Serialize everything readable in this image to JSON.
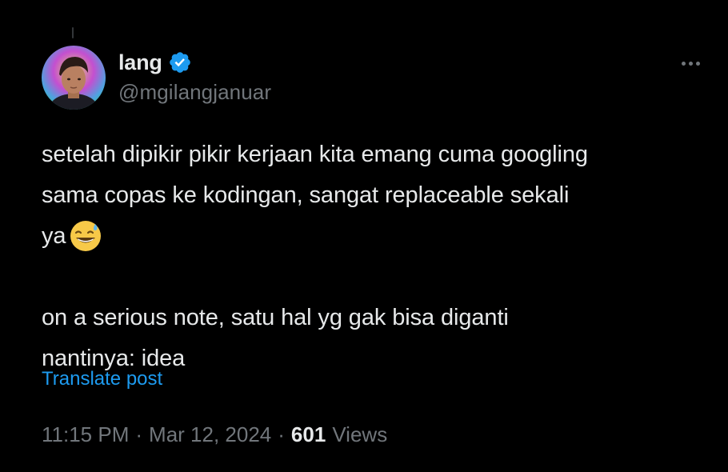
{
  "author": {
    "display_name": "lang",
    "handle": "@mgilangjanuar",
    "verified": true,
    "avatar_icon": "profile-photo-avatar"
  },
  "tweet": {
    "line1": "setelah dipikir pikir kerjaan kita emang cuma googling",
    "line2": "sama copas ke kodingan, sangat replaceable sekali",
    "line3": "ya",
    "emoji": "grinning-face-with-sweat",
    "line4": "on a serious note, satu hal yg gak bisa diganti",
    "line5": "nantinya: idea"
  },
  "translate_label": "Translate post",
  "meta": {
    "time": "11:15 PM",
    "date": "Mar 12, 2024",
    "views_count": "601",
    "views_label": "Views",
    "separator": "·"
  },
  "colors": {
    "background": "#000000",
    "text_primary": "#e7e9ea",
    "text_secondary": "#71767b",
    "link": "#1d9bf0",
    "verified_badge": "#1d9bf0"
  },
  "icons": {
    "more": "more-horizontal-icon",
    "verified": "verified-badge-icon"
  }
}
